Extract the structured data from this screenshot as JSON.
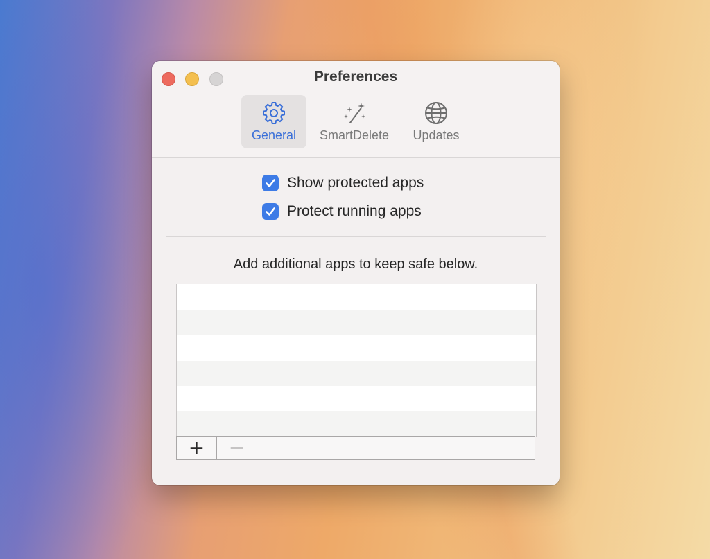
{
  "window": {
    "title": "Preferences"
  },
  "tabs": [
    {
      "label": "General",
      "icon": "gear-icon",
      "selected": true
    },
    {
      "label": "SmartDelete",
      "icon": "magic-wand-icon",
      "selected": false
    },
    {
      "label": "Updates",
      "icon": "globe-icon",
      "selected": false
    }
  ],
  "options": {
    "show_protected": {
      "label": "Show protected apps",
      "checked": true
    },
    "protect_running": {
      "label": "Protect running apps",
      "checked": true
    }
  },
  "safe_list": {
    "instruction": "Add additional apps to keep safe below.",
    "items": [],
    "add_label": "+",
    "remove_label": "−"
  },
  "colors": {
    "accent": "#3d7be6",
    "selected_tab_text": "#3a6fd8",
    "close": "#ed6a5e",
    "minimize": "#f4bf4f",
    "zoom_disabled": "#d6d4d4"
  }
}
